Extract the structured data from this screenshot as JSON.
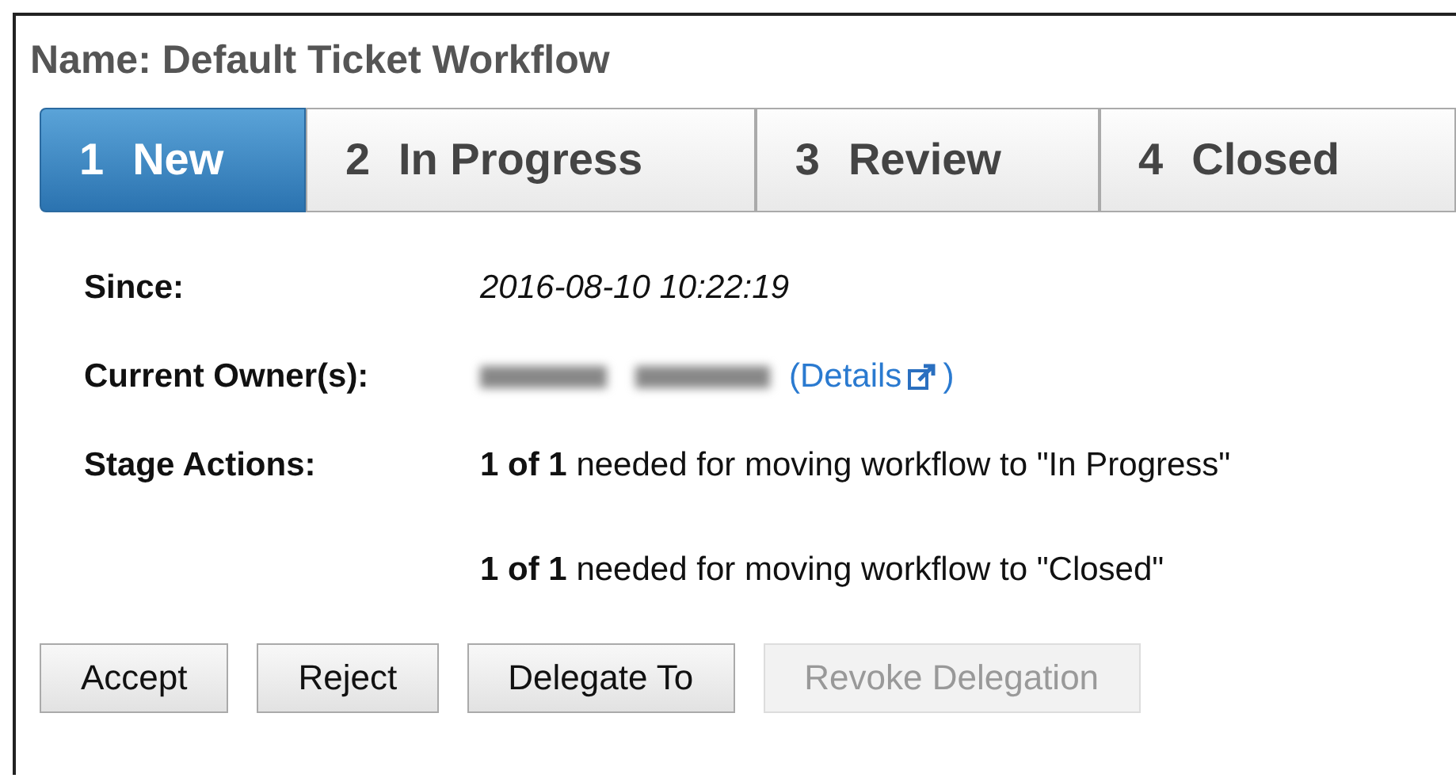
{
  "title": "Name: Default Ticket Workflow",
  "stages": [
    {
      "number": "1",
      "label": "New",
      "selected": true
    },
    {
      "number": "2",
      "label": "In Progress",
      "selected": false
    },
    {
      "number": "3",
      "label": "Review",
      "selected": false
    },
    {
      "number": "4",
      "label": "Closed",
      "selected": false
    }
  ],
  "details": {
    "since": {
      "label": "Since:",
      "value": "2016-08-10 10:22:19"
    },
    "owner": {
      "label": "Current Owner(s):",
      "link": "(Details",
      "link_end": ")"
    },
    "actions": {
      "label": "Stage Actions:",
      "lines": [
        "**1 of 1** needed for moving workflow to \"In Progress\"",
        "**1 of 1** needed for moving workflow to \"Closed\""
      ]
    }
  },
  "buttons": [
    {
      "label": "Accept",
      "disabled": false
    },
    {
      "label": "Reject",
      "disabled": false
    },
    {
      "label": "Delegate To",
      "disabled": false
    },
    {
      "label": "Revoke Delegation",
      "disabled": true
    }
  ]
}
